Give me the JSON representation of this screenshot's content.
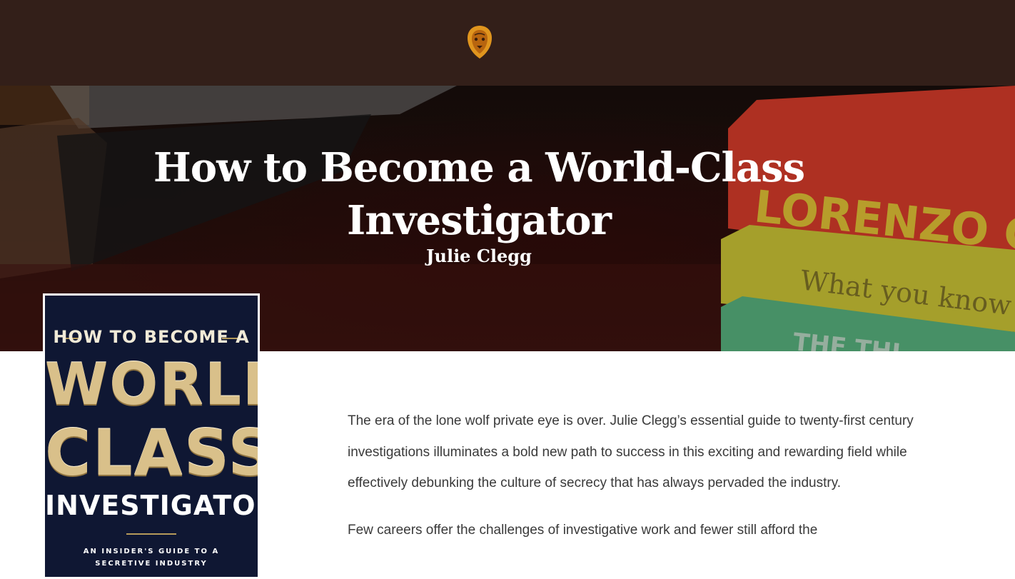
{
  "header": {
    "logo_icon": "lion-head-icon",
    "background": "#331f19",
    "logo_color": "#e0951e"
  },
  "hero": {
    "title": "How to Become a World-Class Investigator",
    "author": "Julie Clegg",
    "background_books": {
      "red_book_text": "LORENZO GOMEZ",
      "yellow_book_text": "What you know",
      "green_book_text": "THE THI"
    }
  },
  "book_cover": {
    "top_line": "HOW TO BECOME A",
    "word1": "WORLD",
    "word2": "CLASS",
    "word3": "INVESTIGATOR",
    "subtitle_line1": "AN INSIDER'S GUIDE TO A",
    "subtitle_line2": "SECRETIVE INDUSTRY"
  },
  "description": {
    "paragraph1": "The era of the lone wolf private eye is over. Julie Clegg’s essential guide to twenty-first century investigations illuminates a bold new path to success in this exciting and rewarding field while effectively debunking the culture of secrecy that has always pervaded the industry.",
    "paragraph2": "Few careers offer the challenges of investigative work and fewer still afford the"
  }
}
